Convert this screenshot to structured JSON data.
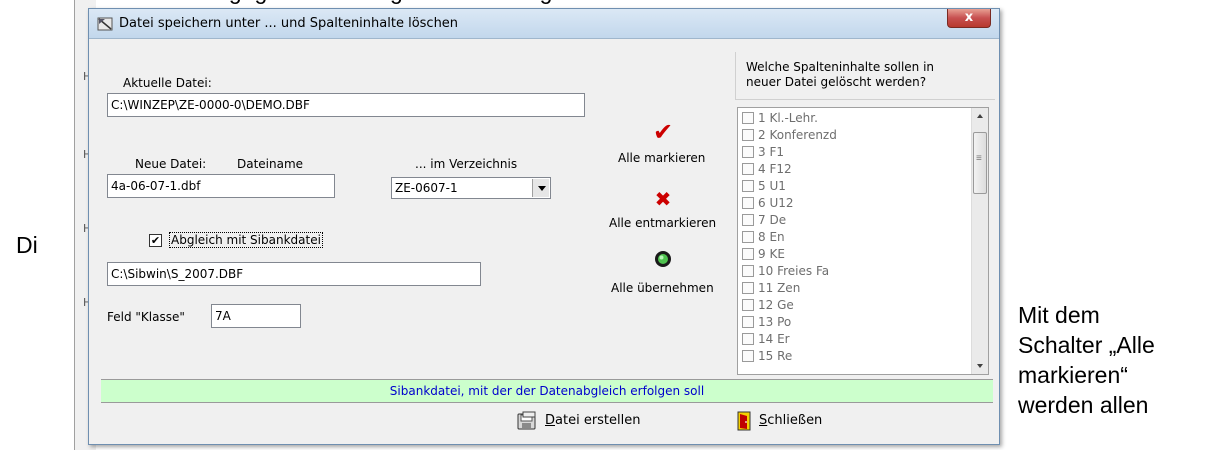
{
  "document": {
    "top_line": "dass keine bereits ausgegebenen Zeugnisse nachträglich verändert werden.",
    "left_fragment": "Di",
    "right_lines": [
      "Mit dem",
      "Schalter „Alle",
      "markieren“",
      "werden allen"
    ]
  },
  "dialog": {
    "title": "Datei speichern unter ...  und Spalteninhalte löschen",
    "close_label": "x",
    "current_file_label": "Aktuelle Datei:",
    "current_file_value": "C:\\WINZEP\\ZE-0000-0\\DEMO.DBF",
    "new_file_label": "Neue Datei:",
    "filename_label": "Dateiname",
    "directory_label": "... im Verzeichnis",
    "filename_value": "4a-06-07-1.dbf",
    "directory_value": "ZE-0607-1",
    "sibank_checkbox_label": "Abgleich mit Sibankdatei",
    "sibank_checked": true,
    "sibank_path_value": "C:\\Sibwin\\S_2007.DBF",
    "klasse_label": "Feld \"Klasse\"",
    "klasse_value": "7A",
    "actions": {
      "mark_all": "Alle markieren",
      "unmark_all": "Alle entmarkieren",
      "accept_all": "Alle übernehmen"
    },
    "columns_panel": {
      "header_line1": "Welche Spalteninhalte sollen in",
      "header_line2": "neuer Datei gelöscht werden?",
      "items": [
        "1  Kl.-Lehr.",
        "2  Konferenzd",
        "3  F1",
        "4  F12",
        "5  U1",
        "6  U12",
        "7  De",
        "8  En",
        "9  KE",
        "10 Freies Fa",
        "11 Zen",
        "12 Ge",
        "13 Po",
        "14 Er",
        "15 Re"
      ]
    },
    "status_text": "Sibankdatei, mit der der Datenabgleich erfolgen soll",
    "create_button": {
      "mnemonic": "D",
      "rest": "atei erstellen"
    },
    "close_button": {
      "mnemonic": "S",
      "rest": "chließen"
    },
    "colors": {
      "status_bg": "#ccffcc",
      "status_text": "#0000cc",
      "check_red": "#cc0000",
      "accept_green": "#2e8b2e"
    }
  }
}
